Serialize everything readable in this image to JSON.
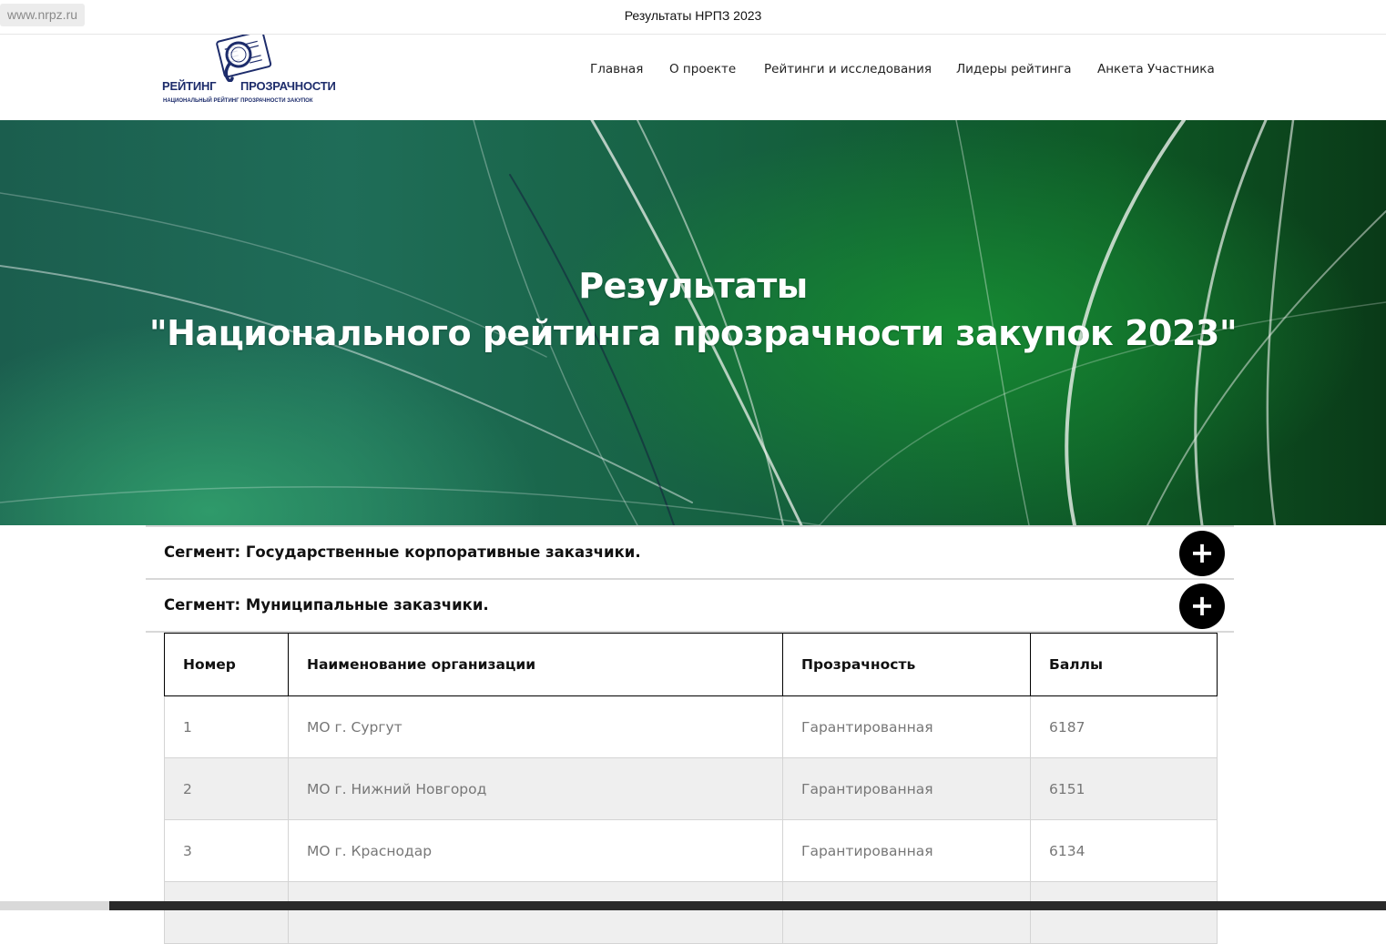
{
  "browser": {
    "url": "www.nrpz.ru",
    "tab_title": "Результаты НРПЗ 2023"
  },
  "logo": {
    "word1": "РЕЙТИНГ",
    "word2": "ПРОЗРАЧНОСТИ",
    "subtitle": "НАЦИОНАЛЬНЫЙ РЕЙТИНГ ПРОЗРАЧНОСТИ ЗАКУПОК",
    "icon": "magnifier-document-icon"
  },
  "nav": {
    "items": [
      {
        "label": "Главная"
      },
      {
        "label": "О проекте"
      },
      {
        "label": "Рейтинги и исследования"
      },
      {
        "label": "Лидеры рейтинга"
      },
      {
        "label": "Анкета Участника"
      }
    ]
  },
  "hero": {
    "line1": "Результаты",
    "line2": "\"Национального рейтинга прозрачности закупок 2023\""
  },
  "accordion": {
    "items": [
      {
        "label": "Сегмент: Государственные корпоративные заказчики.",
        "toggle": "+"
      },
      {
        "label": "Сегмент: Муниципальные заказчики.",
        "toggle": "+"
      }
    ]
  },
  "table": {
    "headers": [
      "Номер",
      "Наименование организации",
      "Прозрачность",
      "Баллы"
    ],
    "rows": [
      [
        "1",
        "МО г. Сургут",
        "Гарантированная",
        "6187"
      ],
      [
        "2",
        "МО г. Нижний Новгород",
        "Гарантированная",
        "6151"
      ],
      [
        "3",
        "МО г. Краснодар",
        "Гарантированная",
        "6134"
      ]
    ]
  },
  "colors": {
    "logo_navy": "#1d2c6b",
    "hero_green": "#15603f",
    "toggle_bg": "#000000",
    "row_alt": "#efefef"
  }
}
